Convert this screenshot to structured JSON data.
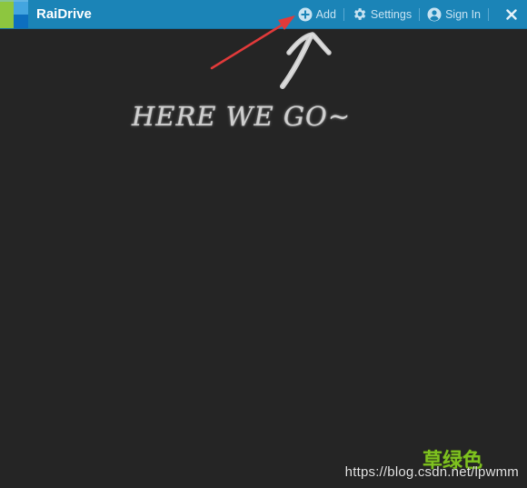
{
  "app": {
    "title": "RaiDrive"
  },
  "toolbar": {
    "add_label": "Add",
    "settings_label": "Settings",
    "signin_label": "Sign In"
  },
  "annotation": {
    "text": "HERE WE GO~"
  },
  "watermark": {
    "chinese_text": "草绿色",
    "url": "https://blog.csdn.net/lpwmm"
  },
  "colors": {
    "titlebar": "#1b84b7",
    "background": "#252525",
    "arrow_red": "#e23a3a",
    "logo_green": "#8dc63f",
    "logo_blue": "#0d6fbf"
  }
}
